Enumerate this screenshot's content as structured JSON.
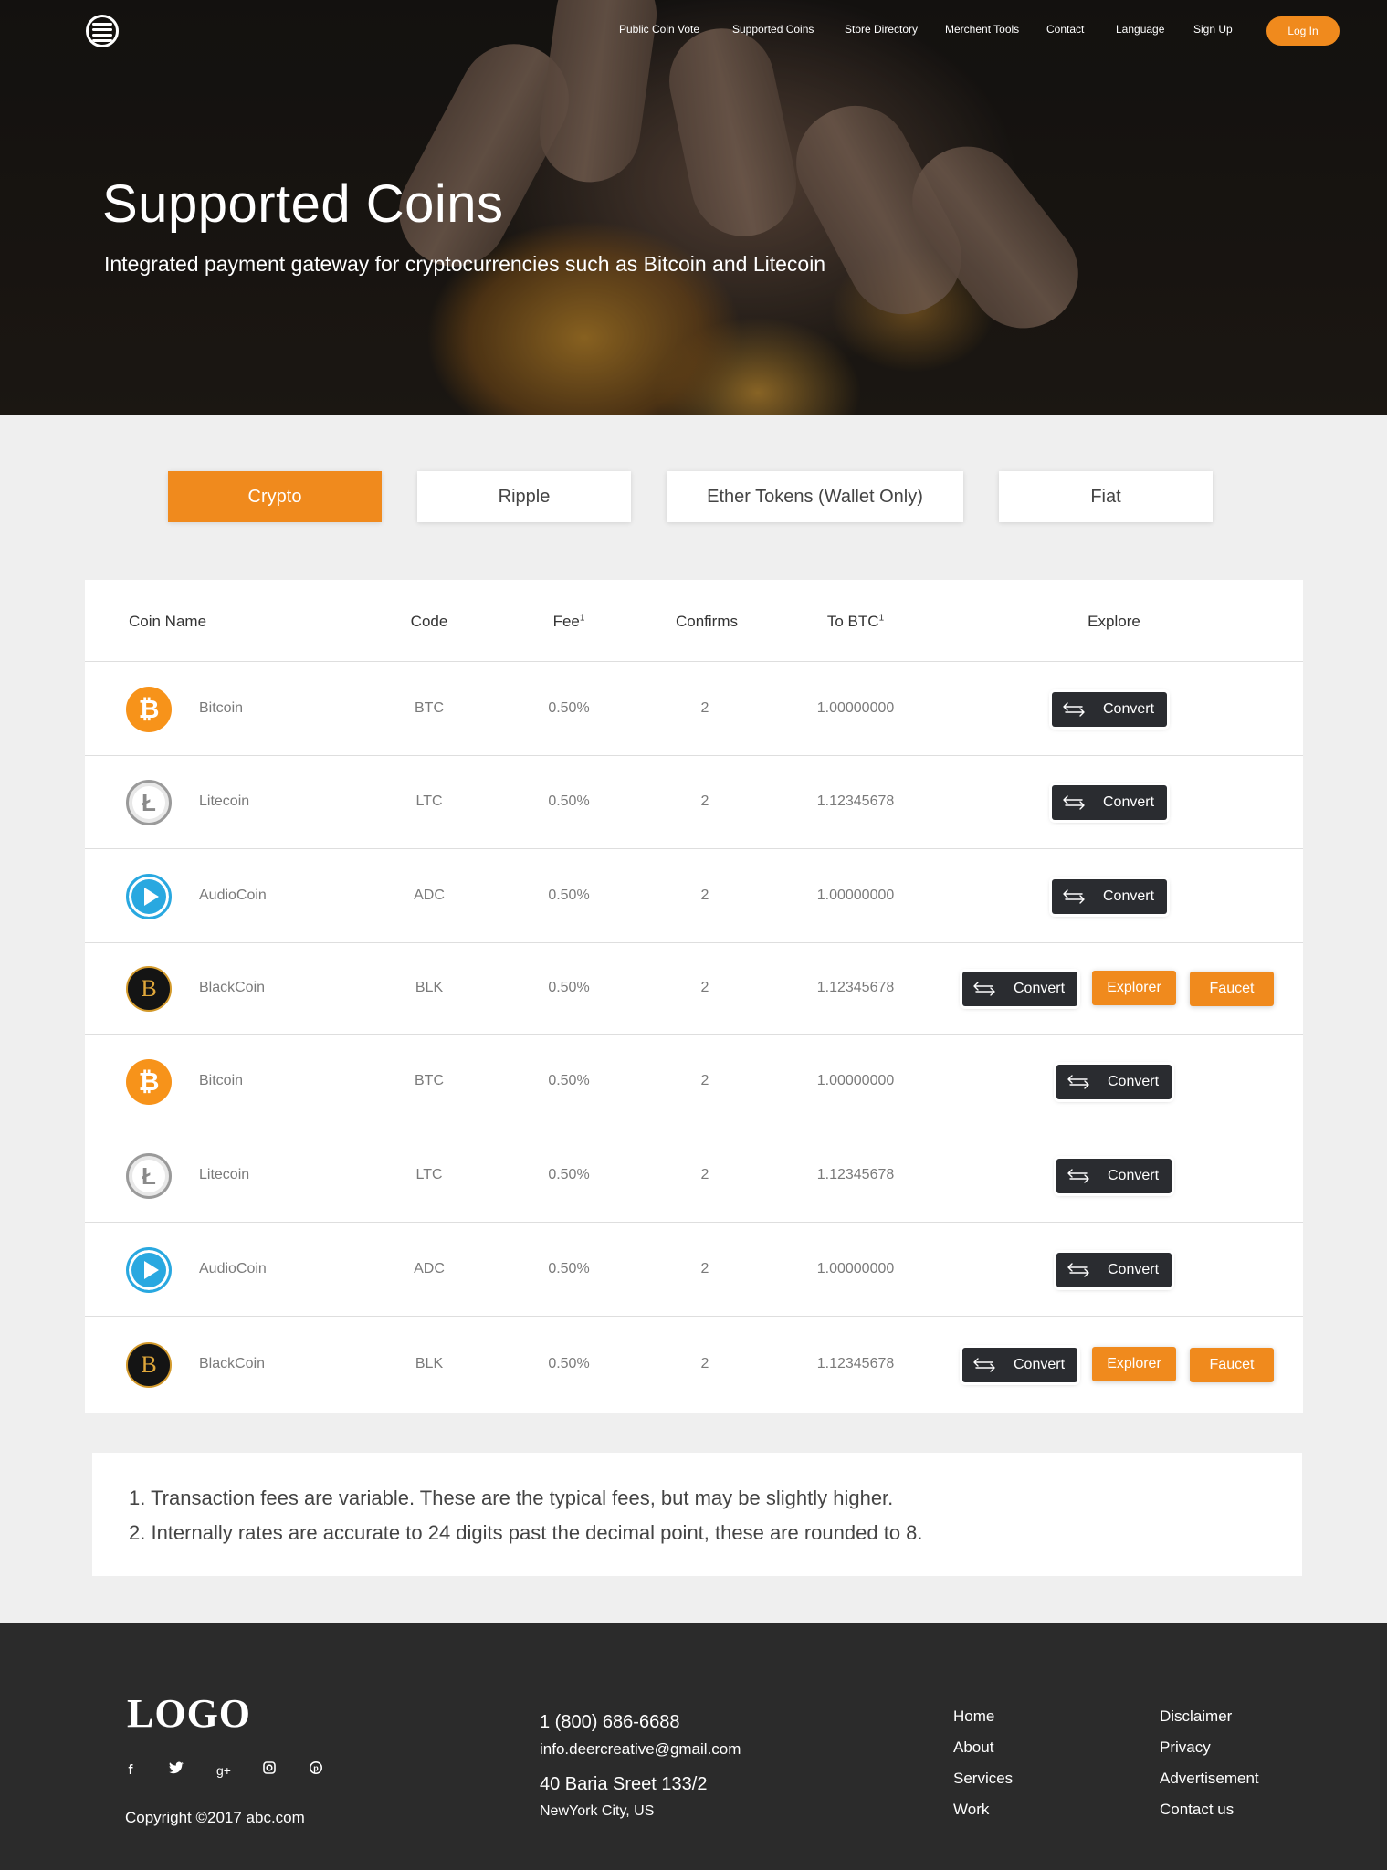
{
  "nav": {
    "items": [
      "Public Coin Vote",
      "Supported Coins",
      "Store Directory",
      "Merchent Tools",
      "Contact",
      "Language",
      "Sign Up"
    ],
    "login_label": "Log In"
  },
  "hero": {
    "title": "Supported Coins",
    "subtitle": "Integrated payment gateway for cryptocurrencies such as Bitcoin and Litecoin"
  },
  "tabs": [
    "Crypto",
    "Ripple",
    "Ether Tokens (Wallet Only)",
    "Fiat"
  ],
  "active_tab": "Crypto",
  "table": {
    "headers": {
      "coin_name": "Coin Name",
      "code": "Code",
      "fee": "Fee",
      "fee_sup": "1",
      "confirms": "Confirms",
      "to_btc": "To BTC",
      "to_btc_sup": "1",
      "explore": "Explore"
    },
    "rows": [
      {
        "icon": "bitcoin-icon",
        "name": "Bitcoin",
        "code": "BTC",
        "fee": "0.50%",
        "confirms": "2",
        "to_btc": "1.00000000",
        "convert": "Convert"
      },
      {
        "icon": "litecoin-icon",
        "name": "Litecoin",
        "code": "LTC",
        "fee": "0.50%",
        "confirms": "2",
        "to_btc": "1.12345678",
        "convert": "Convert"
      },
      {
        "icon": "audiocoin-icon",
        "name": "AudioCoin",
        "code": "ADC",
        "fee": "0.50%",
        "confirms": "2",
        "to_btc": "1.00000000",
        "convert": "Convert"
      },
      {
        "icon": "blackcoin-icon",
        "name": "BlackCoin",
        "code": "BLK",
        "fee": "0.50%",
        "confirms": "2",
        "to_btc": "1.12345678",
        "convert": "Convert",
        "explorer": "Explorer",
        "faucet": "Faucet"
      },
      {
        "icon": "bitcoin-icon",
        "name": "Bitcoin",
        "code": "BTC",
        "fee": "0.50%",
        "confirms": "2",
        "to_btc": "1.00000000",
        "convert": "Convert"
      },
      {
        "icon": "litecoin-icon",
        "name": "Litecoin",
        "code": "LTC",
        "fee": "0.50%",
        "confirms": "2",
        "to_btc": "1.12345678",
        "convert": "Convert"
      },
      {
        "icon": "audiocoin-icon",
        "name": "AudioCoin",
        "code": "ADC",
        "fee": "0.50%",
        "confirms": "2",
        "to_btc": "1.00000000",
        "convert": "Convert"
      },
      {
        "icon": "blackcoin-icon",
        "name": "BlackCoin",
        "code": "BLK",
        "fee": "0.50%",
        "confirms": "2",
        "to_btc": "1.12345678",
        "convert": "Convert",
        "explorer": "Explorer",
        "faucet": "Faucet"
      }
    ]
  },
  "notes": [
    "1. Transaction fees are variable. These are the typical fees, but may be slightly higher.",
    "2. Internally rates are accurate to 24 digits past the decimal point, these are rounded to 8."
  ],
  "footer": {
    "logo": "LOGO",
    "social": [
      "facebook-icon",
      "twitter-icon",
      "google-plus-icon",
      "instagram-icon",
      "pinterest-icon"
    ],
    "copyright": "Copyright ©2017 abc.com",
    "phone": "1 (800) 686-6688",
    "email": "info.deercreative@gmail.com",
    "address_line1": "40 Baria Sreet 133/2",
    "address_line2": "NewYork City, US",
    "links_col1": [
      "Home",
      "About",
      "Services",
      "Work"
    ],
    "links_col2": [
      "Disclaimer",
      "Privacy",
      "Advertisement",
      "Contact us"
    ]
  },
  "colors": {
    "accent": "#f08a1d",
    "dark_button": "#2a2c30",
    "footer_bg": "#2b2b2b",
    "page_bg": "#efefef"
  }
}
